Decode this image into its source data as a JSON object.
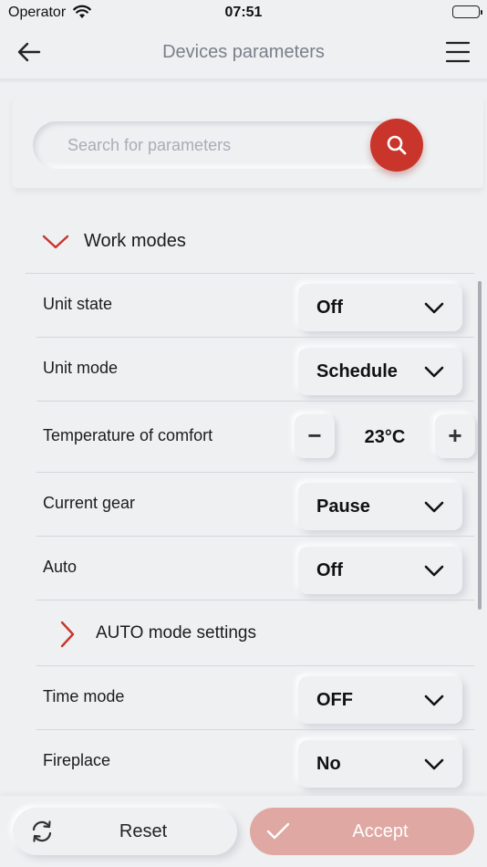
{
  "status_bar": {
    "carrier": "Operator",
    "time": "07:51"
  },
  "header": {
    "title": "Devices parameters",
    "back_icon": "arrow-left-icon",
    "menu_icon": "hamburger-menu-icon"
  },
  "search": {
    "placeholder": "Search for parameters",
    "icon": "search-icon"
  },
  "section": {
    "label": "Work modes",
    "expanded": true
  },
  "rows": [
    {
      "label": "Unit state",
      "value": "Off"
    },
    {
      "label": "Unit mode",
      "value": "Schedule"
    },
    {
      "label": "Temperature of comfort",
      "value": "23°C",
      "minus": "−",
      "plus": "+"
    },
    {
      "label": "Current gear",
      "value": "Pause"
    },
    {
      "label": "Auto",
      "value": "Off"
    },
    {
      "label": "AUTO mode settings"
    },
    {
      "label": "Time mode",
      "value": "OFF"
    },
    {
      "label": "Fireplace",
      "value": "No"
    }
  ],
  "footer": {
    "reset_label": "Reset",
    "accept_label": "Accept"
  },
  "colors": {
    "accent": "#c9352a",
    "accept_disabled": "#e0a8a3",
    "background": "#eef0f2"
  }
}
